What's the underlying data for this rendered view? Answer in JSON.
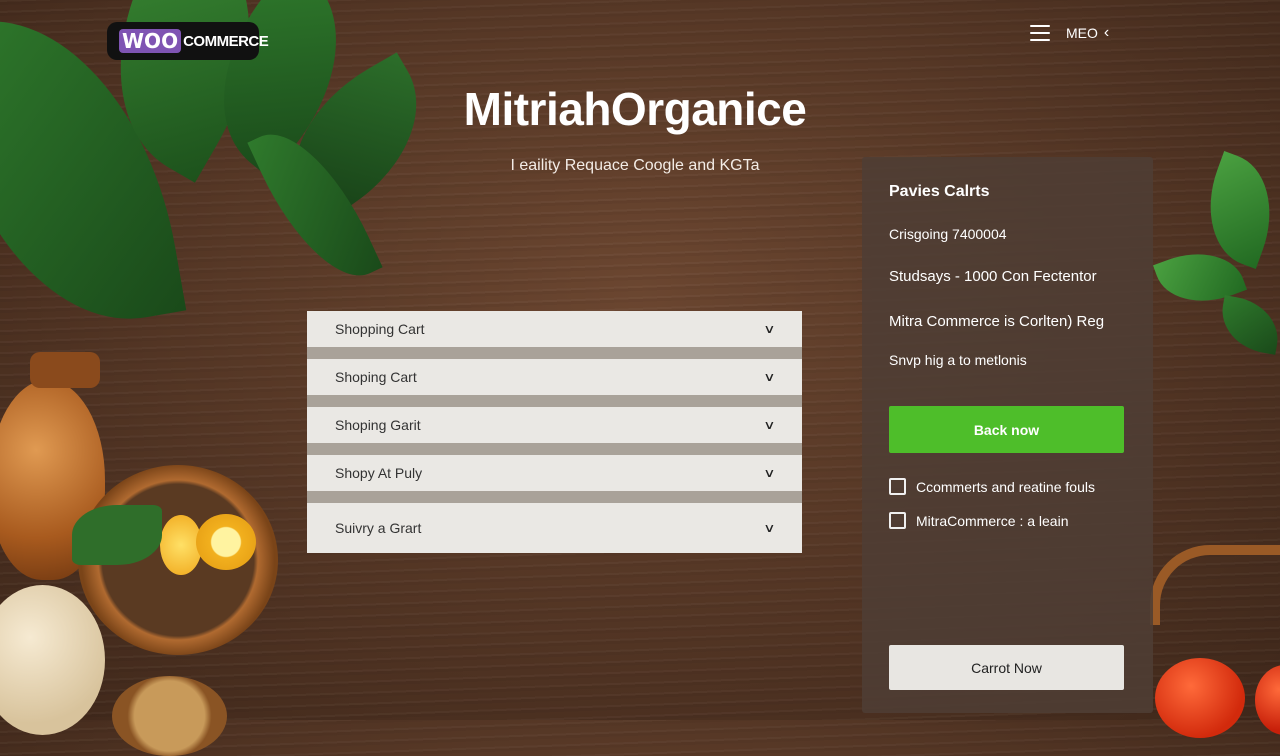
{
  "brand": {
    "logo_woo": "WOO",
    "logo_commerce": "COMMERCE"
  },
  "nav": {
    "menu_label": "MEO"
  },
  "hero": {
    "title": "MitriahOrganice",
    "subtitle": "I eaility Requace Coogle and KGTa"
  },
  "accordion": {
    "items": [
      {
        "label": "Shopping Cart"
      },
      {
        "label": "Shoping Cart"
      },
      {
        "label": "Shoping Garit"
      },
      {
        "label": "Shopy At Puly"
      },
      {
        "label": "Suivry a Grart"
      }
    ]
  },
  "panel": {
    "title": "Pavies Calrts",
    "line1": "Crisgoing 7400004",
    "line2": "Studsays - 1000 Con Fectentor",
    "line3": "Mitra Commerce is Corlten) Reg",
    "line4": "Snvp hig a to metlonis",
    "primary_button": "Back now",
    "checkboxes": [
      {
        "label": "Ccommerts and reatine fouls",
        "checked": false
      },
      {
        "label": "MitraCommerce : a leain",
        "checked": false
      }
    ],
    "secondary_button": "Carrot Now"
  },
  "colors": {
    "accent_green": "#4ebe2a",
    "logo_purple": "#7f54b3"
  }
}
